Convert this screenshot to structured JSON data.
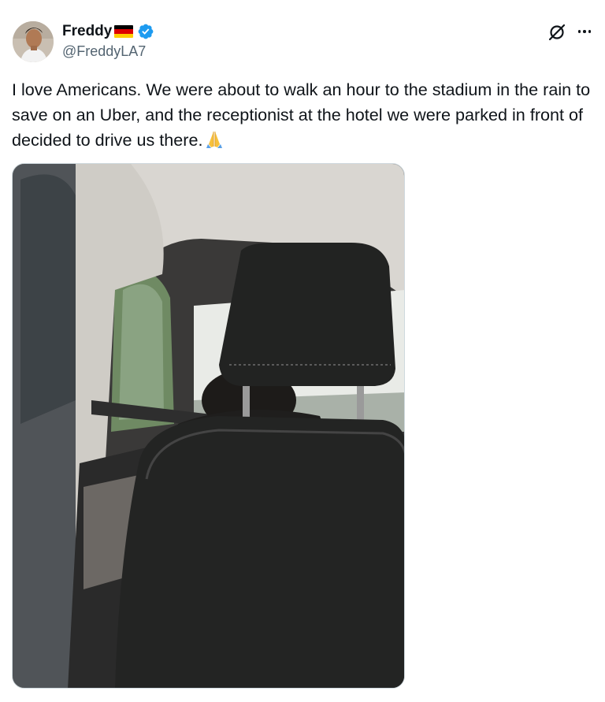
{
  "author": {
    "display_name": "Freddy",
    "handle": "@FreddyLA7",
    "flag_icon": "germany-flag-icon",
    "verified_icon": "verified-badge-icon",
    "verified_color": "#1d9bf0"
  },
  "actions": {
    "grok_icon": "grok-icon",
    "more_icon": "more-dots-icon"
  },
  "tweet": {
    "text": "I love Americans. We were about to walk an hour to the stadium in the rain to save on an Uber, and the receptionist at the hotel we were parked in front of decided to drive us there.",
    "emoji": "folded-hands-emoji"
  },
  "media": {
    "type": "photo"
  }
}
